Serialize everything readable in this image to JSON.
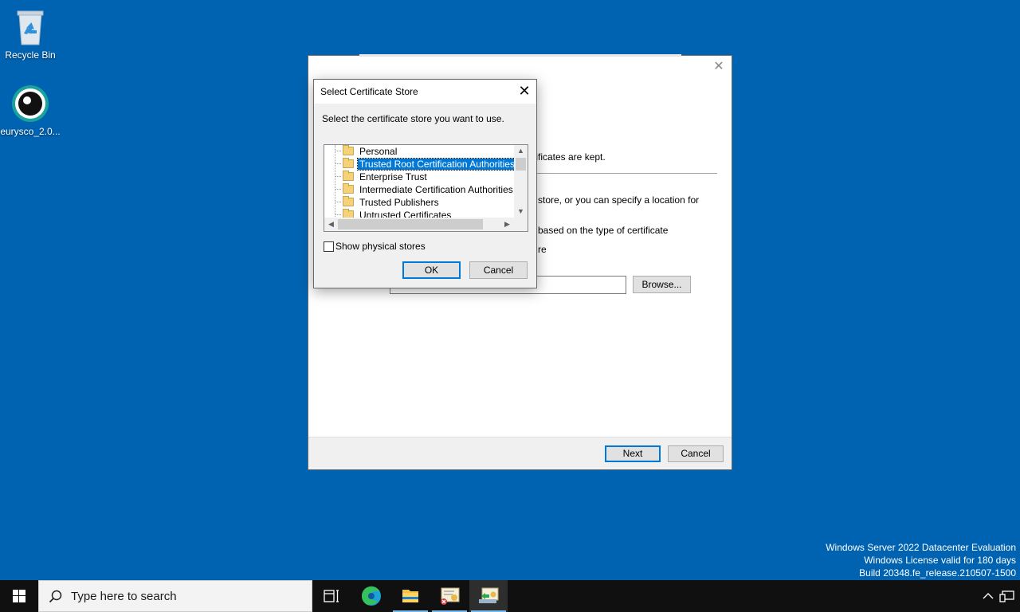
{
  "desktop": {
    "icons": [
      {
        "label": "Recycle Bin",
        "icon": "recycle-bin-icon"
      },
      {
        "label": "eurysco_2.0...",
        "icon": "eurysco-icon"
      }
    ],
    "watermark": {
      "line1": "Windows Server 2022 Datacenter Evaluation",
      "line2": "Windows License valid for 180 days",
      "line3": "Build 20348.fe_release.210507-1500"
    }
  },
  "wizard": {
    "text1": "rtificates are kept.",
    "text2": "e store, or you can specify a location for",
    "text3": "e based on the type of certificate",
    "text4": "re",
    "browse_label": "Browse...",
    "next_label": "Next",
    "cancel_label": "Cancel"
  },
  "dialog": {
    "title": "Select Certificate Store",
    "instruction": "Select the certificate store you want to use.",
    "stores": [
      {
        "label": "Personal",
        "selected": false
      },
      {
        "label": "Trusted Root Certification Authorities",
        "selected": true
      },
      {
        "label": "Enterprise Trust",
        "selected": false
      },
      {
        "label": "Intermediate Certification Authorities",
        "selected": false
      },
      {
        "label": "Trusted Publishers",
        "selected": false
      },
      {
        "label": "Untrusted Certificates",
        "selected": false
      }
    ],
    "show_physical_label": "Show physical stores",
    "show_physical_checked": false,
    "ok_label": "OK",
    "cancel_label": "Cancel"
  },
  "taskbar": {
    "search_placeholder": "Type here to search",
    "apps": [
      "task-view-icon",
      "edge-icon",
      "file-explorer-icon",
      "certificate-manager-icon",
      "certificate-import-wizard-icon"
    ]
  },
  "colors": {
    "desktop_bg": "#0063b1",
    "selection": "#0078d7",
    "taskbar_bg": "#101010"
  }
}
